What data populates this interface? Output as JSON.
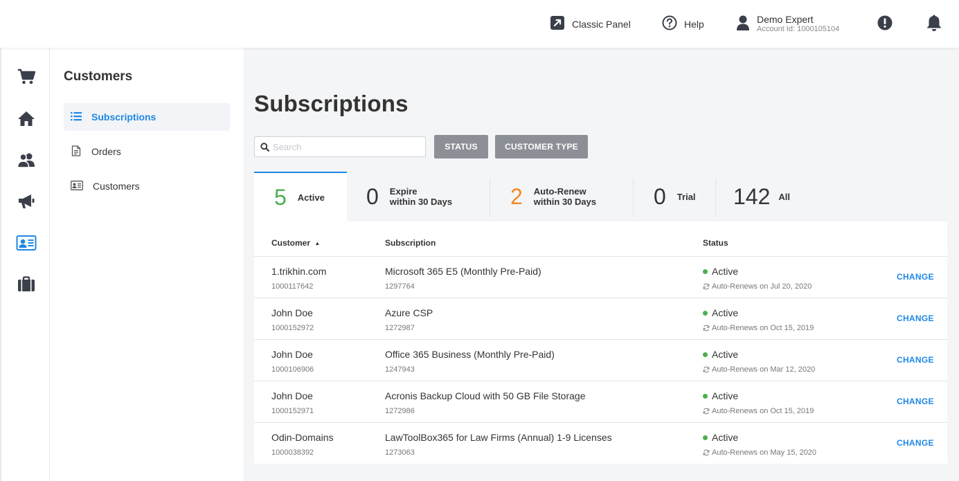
{
  "header": {
    "classic_panel": "Classic Panel",
    "help": "Help",
    "user_name": "Demo Expert",
    "account_id": "Account Id: 1000105104"
  },
  "rail": {
    "items": [
      "cart-icon",
      "home-icon",
      "users-icon",
      "megaphone-icon",
      "contact-card-icon",
      "briefcase-icon"
    ],
    "active": "contact-card-icon"
  },
  "subnav": {
    "title": "Customers",
    "items": [
      {
        "label": "Subscriptions",
        "icon": "list-icon",
        "active": true
      },
      {
        "label": "Orders",
        "icon": "document-icon",
        "active": false
      },
      {
        "label": "Customers",
        "icon": "id-card-icon",
        "active": false
      }
    ]
  },
  "main": {
    "title": "Subscriptions",
    "search_placeholder": "Search",
    "filters": {
      "status": "STATUS",
      "customer_type": "CUSTOMER TYPE"
    }
  },
  "tabs": [
    {
      "count": "5",
      "label_line1": "Active",
      "label_line2": "",
      "color": "#4caf50"
    },
    {
      "count": "0",
      "label_line1": "Expire",
      "label_line2": "within 30 Days",
      "color": "#333333"
    },
    {
      "count": "2",
      "label_line1": "Auto-Renew",
      "label_line2": "within 30 Days",
      "color": "#f08a24"
    },
    {
      "count": "0",
      "label_line1": "Trial",
      "label_line2": "",
      "color": "#333333"
    },
    {
      "count": "142",
      "label_line1": "All",
      "label_line2": "",
      "color": "#333333"
    }
  ],
  "table": {
    "headers": {
      "customer": "Customer",
      "subscription": "Subscription",
      "status": "Status"
    },
    "sort_indicator": "▲",
    "action_label": "CHANGE",
    "rows": [
      {
        "customer": "1.trikhin.com",
        "customer_id": "1000117642",
        "subscription": "Microsoft 365 E5 (Monthly Pre-Paid)",
        "subscription_id": "1297764",
        "status": "Active",
        "renew": "Auto-Renews on Jul 20, 2020"
      },
      {
        "customer": "John Doe",
        "customer_id": "1000152972",
        "subscription": "Azure CSP",
        "subscription_id": "1272987",
        "status": "Active",
        "renew": "Auto-Renews on Oct 15, 2019"
      },
      {
        "customer": "John Doe",
        "customer_id": "1000106906",
        "subscription": "Office 365 Business (Monthly Pre-Paid)",
        "subscription_id": "1247943",
        "status": "Active",
        "renew": "Auto-Renews on Mar 12, 2020"
      },
      {
        "customer": "John Doe",
        "customer_id": "1000152971",
        "subscription": "Acronis Backup Cloud with 50 GB File Storage",
        "subscription_id": "1272986",
        "status": "Active",
        "renew": "Auto-Renews on Oct 15, 2019"
      },
      {
        "customer": "Odin-Domains",
        "customer_id": "1000038392",
        "subscription": "LawToolBox365 for Law Firms (Annual) 1-9 Licenses",
        "subscription_id": "1273063",
        "status": "Active",
        "renew": "Auto-Renews on May 15, 2020"
      }
    ]
  },
  "colors": {
    "accent": "#1e88e5",
    "active_green": "#4caf50",
    "renew_orange": "#f08a24",
    "filter_grey": "#8c9096"
  }
}
